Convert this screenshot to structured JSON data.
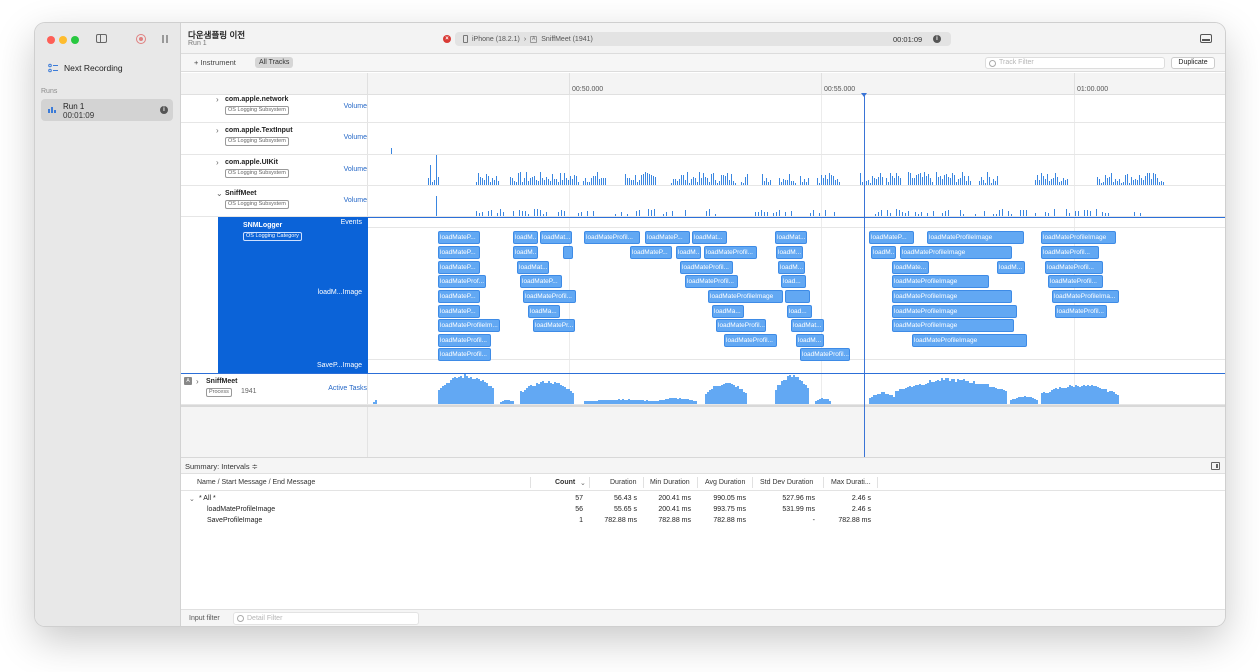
{
  "sidebar": {
    "next_recording": "Next Recording",
    "runs_heading": "Runs",
    "run": {
      "name": "Run 1",
      "time": "00:01:09"
    }
  },
  "toolbar": {
    "title": "다운샘플링 이전",
    "subtitle": "Run 1",
    "device": "iPhone (18.2.1)",
    "separator": "›",
    "process": "SniffMeet (1941)",
    "clock": "00:01:09"
  },
  "filterbar": {
    "add_instrument": "+ Instrument",
    "all_tracks": "All Tracks",
    "track_filter_placeholder": "Track Filter",
    "duplicate": "Duplicate"
  },
  "ruler": {
    "ticks": [
      "00:50.000",
      "00:55.000",
      "01:00.000"
    ]
  },
  "tracks": [
    {
      "name": "com.apple.network",
      "badge": "OS Logging Subsystem",
      "kind": "Volume"
    },
    {
      "name": "com.apple.TextInput",
      "badge": "OS Logging Subsystem",
      "kind": "Volume"
    },
    {
      "name": "com.apple.UIKit",
      "badge": "OS Logging Subsystem",
      "kind": "Volume"
    },
    {
      "name": "SniffMeet",
      "badge": "OS Logging Subsystem",
      "kind": "Volume"
    }
  ],
  "logger": {
    "name": "SNMLogger",
    "badge": "OS Logging Category",
    "events_label": "Events",
    "lane1_label": "loadM...Image",
    "lane2_label": "SaveP...Image"
  },
  "process_track": {
    "name": "SniffMeet",
    "badge": "Process",
    "pid": "1941",
    "kind": "Active Tasks"
  },
  "summary": {
    "title": "Summary: Intervals ≑",
    "columns": [
      "Name / Start Message / End Message",
      "Count",
      "Duration",
      "Min Duration",
      "Avg Duration",
      "Std Dev Duration",
      "Max Durati..."
    ],
    "rows": [
      {
        "name": "* All *",
        "count": "57",
        "duration": "56.43 s",
        "min": "200.41 ms",
        "avg": "990.05 ms",
        "std": "527.96 ms",
        "max": "2.46 s"
      },
      {
        "name": "loadMateProfileImage",
        "count": "56",
        "duration": "55.65 s",
        "min": "200.41 ms",
        "avg": "993.75 ms",
        "std": "531.99 ms",
        "max": "2.46 s"
      },
      {
        "name": "SaveProfileImage",
        "count": "1",
        "duration": "782.88 ms",
        "min": "782.88 ms",
        "avg": "782.88 ms",
        "std": "-",
        "max": "782.88 ms"
      }
    ]
  },
  "footer": {
    "label": "Input filter",
    "placeholder": "Detail Filter"
  },
  "intervals": [
    [
      "loadMateP...",
      403,
      208,
      42
    ],
    [
      "loadMateP...",
      403,
      223,
      42
    ],
    [
      "loadMateP...",
      403,
      238,
      42
    ],
    [
      "loadMateProf...",
      403,
      252,
      48
    ],
    [
      "loadMateP...",
      403,
      267,
      42
    ],
    [
      "loadMateP...",
      403,
      282,
      42
    ],
    [
      "loadMateProfileIm...",
      403,
      296,
      62
    ],
    [
      "loadMateProfil...",
      403,
      311,
      53
    ],
    [
      "loadMateProfil...",
      403,
      325,
      53
    ],
    [
      "loadM...",
      478,
      208,
      25
    ],
    [
      "loadM...",
      478,
      223,
      25
    ],
    [
      "loadMat...",
      482,
      238,
      32
    ],
    [
      "loadMateP...",
      485,
      252,
      42
    ],
    [
      "loadMateProfil...",
      488,
      267,
      53
    ],
    [
      "loadMa...",
      493,
      282,
      32
    ],
    [
      "loadMatePr...",
      498,
      296,
      42
    ],
    [
      "loadMat...",
      505,
      208,
      32
    ],
    [
      "",
      528,
      223,
      10
    ],
    [
      "loadMateProfil...",
      549,
      208,
      56
    ],
    [
      "loadMateP...",
      595,
      223,
      42
    ],
    [
      "loadMateP...",
      610,
      208,
      45
    ],
    [
      "loadM...",
      641,
      223,
      25
    ],
    [
      "loadMat...",
      657,
      208,
      35
    ],
    [
      "loadMateProfil...",
      669,
      223,
      53
    ],
    [
      "loadMateProfil...",
      645,
      238,
      53
    ],
    [
      "loadMateProfil...",
      650,
      252,
      53
    ],
    [
      "loadMateProfileImage",
      673,
      267,
      75
    ],
    [
      "loadMa...",
      677,
      282,
      32
    ],
    [
      "loadMateProfil...",
      681,
      296,
      50
    ],
    [
      "loadMateProfil...",
      689,
      311,
      53
    ],
    [
      "loadMat...",
      740,
      208,
      32
    ],
    [
      "loadM...",
      741,
      223,
      27
    ],
    [
      "loadM...",
      743,
      238,
      27
    ],
    [
      "load...",
      746,
      252,
      25
    ],
    [
      "",
      750,
      267,
      25
    ],
    [
      "load...",
      752,
      282,
      25
    ],
    [
      "loadMat...",
      756,
      296,
      33
    ],
    [
      "loadM...",
      761,
      311,
      28
    ],
    [
      "loadMateProfil...",
      765,
      325,
      50
    ],
    [
      "loadMateP...",
      834,
      208,
      45
    ],
    [
      "loadMateProfileImage",
      892,
      208,
      97
    ],
    [
      "loadM...",
      836,
      223,
      25
    ],
    [
      "loadMateProfileImage",
      865,
      223,
      112
    ],
    [
      "loadMate...",
      857,
      238,
      37
    ],
    [
      "loadM...",
      962,
      238,
      28
    ],
    [
      "loadMateProfileImage",
      857,
      252,
      97
    ],
    [
      "loadMateProfileImage",
      857,
      267,
      120
    ],
    [
      "loadMateProfileImage",
      857,
      282,
      125
    ],
    [
      "loadMateProfileImage",
      857,
      296,
      122
    ],
    [
      "loadMateProfileImage",
      877,
      311,
      115
    ],
    [
      "loadMateProfileImage",
      1006,
      208,
      75
    ],
    [
      "loadMateProfil...",
      1006,
      223,
      58
    ],
    [
      "loadMateProfil...",
      1010,
      238,
      58
    ],
    [
      "loadMateProfil...",
      1013,
      252,
      55
    ],
    [
      "loadMateProfileIma...",
      1017,
      267,
      67
    ],
    [
      "loadMateProfil...",
      1020,
      282,
      52
    ]
  ],
  "colors": {
    "accent": "#0b63d8",
    "interval": "#62a8f3",
    "error": "#d93a35"
  }
}
